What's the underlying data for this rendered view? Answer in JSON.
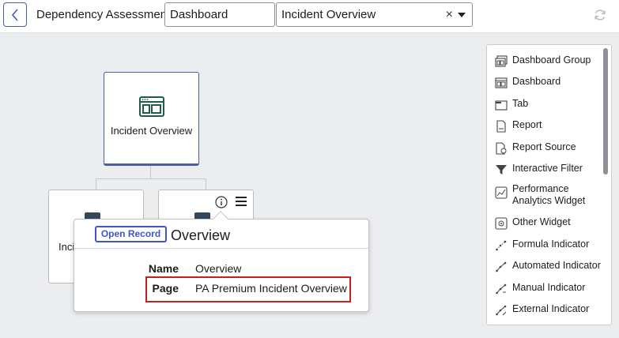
{
  "header": {
    "title": "Dependency Assessment",
    "type_select": "Dashboard",
    "record_select": "Incident Overview",
    "clear_glyph": "×"
  },
  "canvas": {
    "main_node_label": "Incident Overview",
    "child_node_label_partial": "Inci"
  },
  "popover": {
    "open_record_label": "Open Record",
    "title": "Overview",
    "fields": [
      {
        "key": "Name",
        "value": "Overview"
      },
      {
        "key": "Page",
        "value": "PA Premium Incident Overview"
      }
    ]
  },
  "palette": {
    "items": [
      {
        "label": "Dashboard Group",
        "icon": "dashboard-group-icon"
      },
      {
        "label": "Dashboard",
        "icon": "dashboard-icon"
      },
      {
        "label": "Tab",
        "icon": "tab-icon"
      },
      {
        "label": "Report",
        "icon": "report-icon"
      },
      {
        "label": "Report Source",
        "icon": "report-source-icon"
      },
      {
        "label": "Interactive Filter",
        "icon": "filter-icon"
      },
      {
        "label": "Performance Analytics Widget",
        "icon": "pa-widget-icon"
      },
      {
        "label": "Other Widget",
        "icon": "widget-icon"
      },
      {
        "label": "Formula Indicator",
        "icon": "indicator-icon"
      },
      {
        "label": "Automated Indicator",
        "icon": "indicator-icon"
      },
      {
        "label": "Manual Indicator",
        "icon": "indicator-icon"
      },
      {
        "label": "External Indicator",
        "icon": "indicator-icon"
      }
    ]
  },
  "colors": {
    "accent": "#4a5da8",
    "open_record": "#4056c4",
    "highlight": "#c81e1e",
    "background": "#ebedef"
  }
}
